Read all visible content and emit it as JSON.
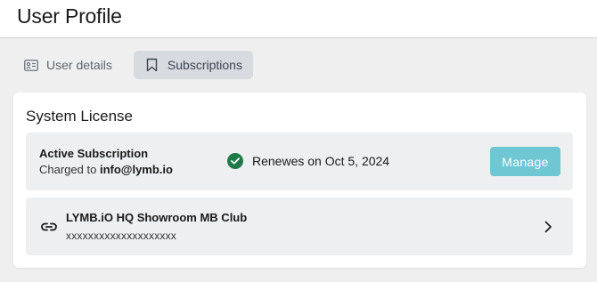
{
  "header": {
    "title": "User Profile"
  },
  "tabs": [
    {
      "label": "User details",
      "icon": "id-card-icon",
      "active": false
    },
    {
      "label": "Subscriptions",
      "icon": "bookmark-icon",
      "active": true
    }
  ],
  "license": {
    "title": "System License",
    "subscription": {
      "label": "Active Subscription",
      "charged_prefix": "Charged to",
      "email": "info@lymb.io",
      "status_icon": "check-circle-icon",
      "renew_text": "Renewes on Oct 5, 2024",
      "manage_label": "Manage"
    },
    "linked_item": {
      "icon": "link-icon",
      "title": "LYMB.iO HQ Showroom MB Club",
      "subtitle": "xxxxxxxxxxxxxxxxxxxx",
      "action_icon": "chevron-right-icon"
    }
  },
  "colors": {
    "accent_button": "#6ec7d2",
    "success": "#1f7a4a",
    "active_tab_bg": "#d7dadf",
    "page_bg": "#efefef"
  }
}
